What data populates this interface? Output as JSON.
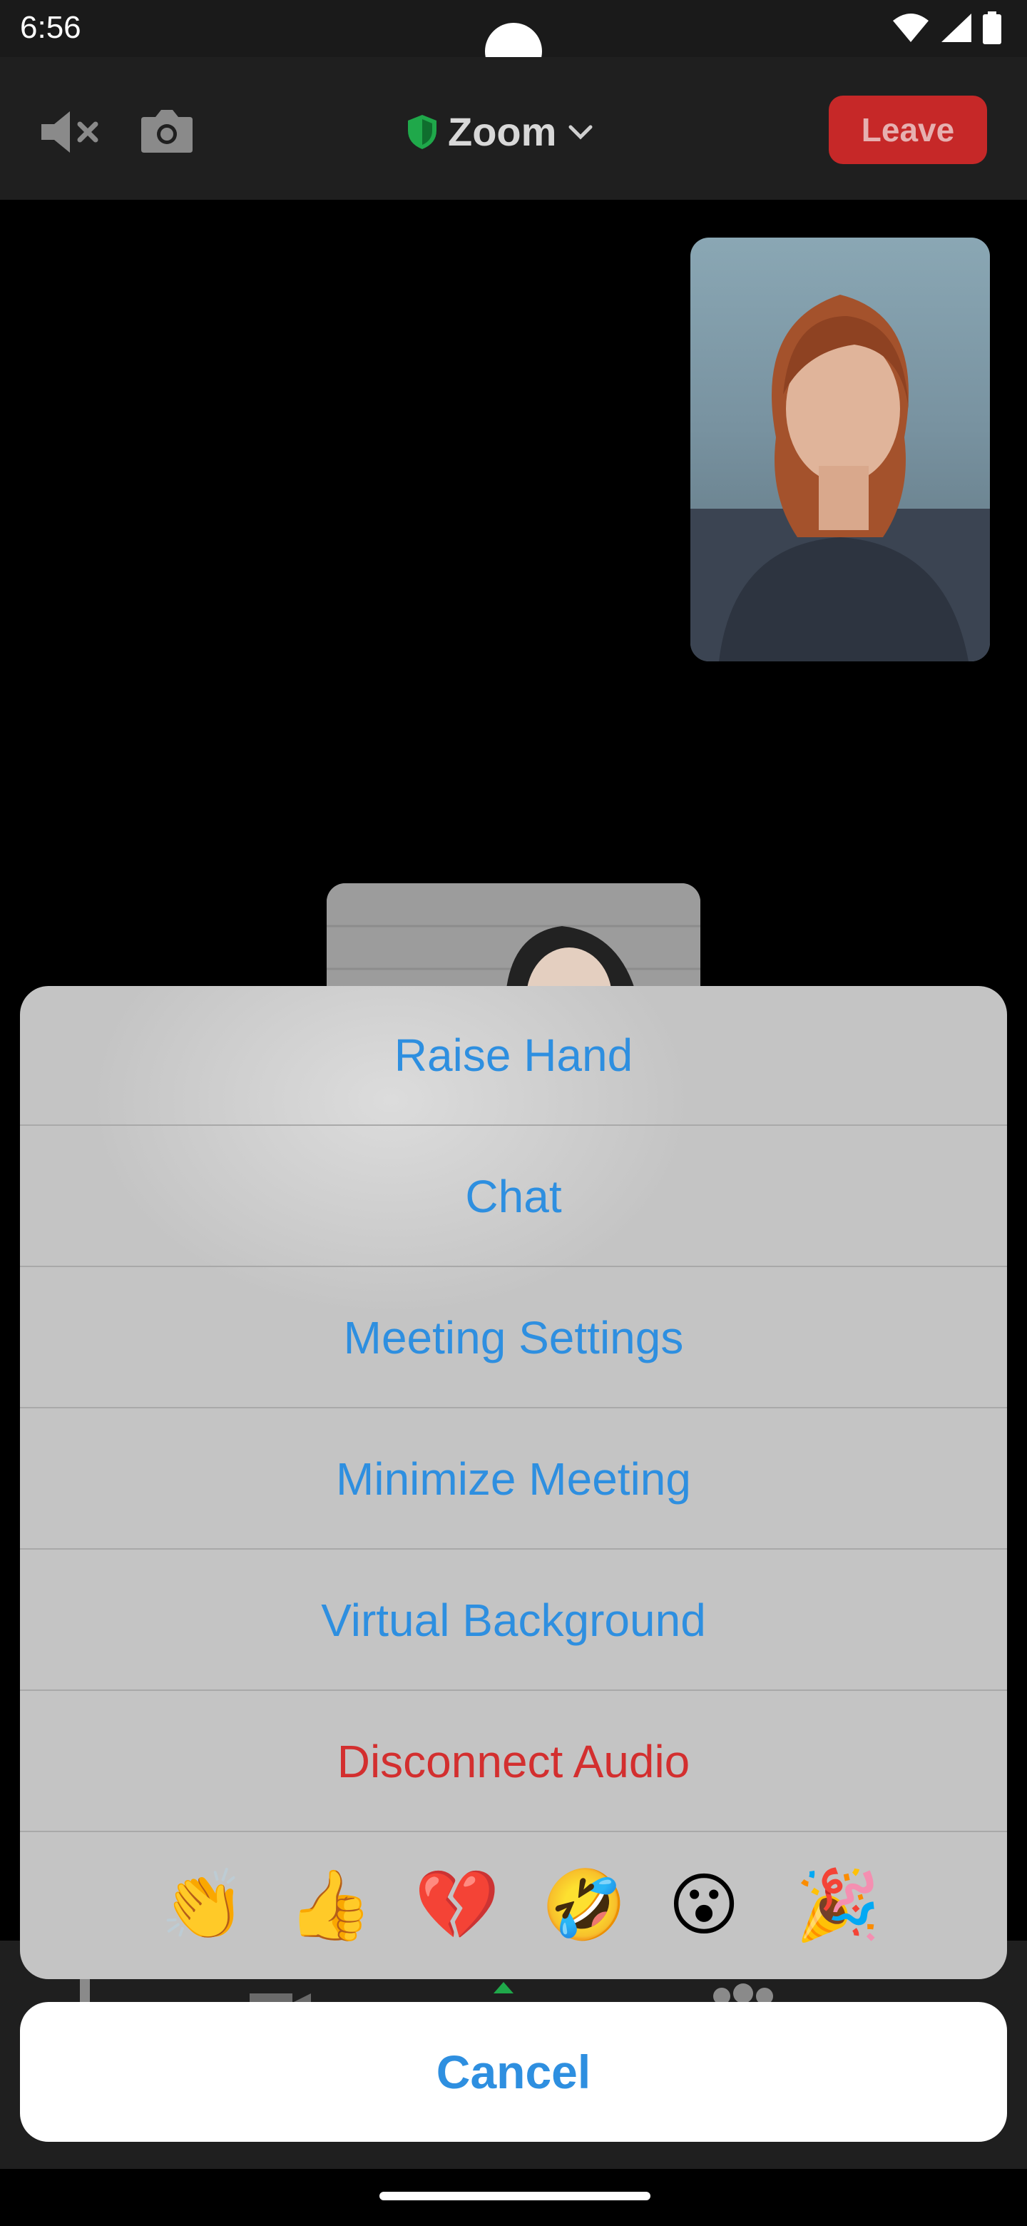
{
  "status_bar": {
    "time": "6:56"
  },
  "toolbar": {
    "title": "Zoom",
    "leave_label": "Leave",
    "icons": [
      "speaker-muted-icon",
      "switch-camera-icon",
      "shield-icon",
      "chevron-down-icon"
    ]
  },
  "action_sheet": {
    "items": [
      {
        "label": "Raise Hand"
      },
      {
        "label": "Chat"
      },
      {
        "label": "Meeting Settings"
      },
      {
        "label": "Minimize Meeting"
      },
      {
        "label": "Virtual Background"
      },
      {
        "label": "Disconnect Audio"
      }
    ],
    "reactions": [
      {
        "name": "clap",
        "glyph": "👏"
      },
      {
        "name": "thumbs-up",
        "glyph": "👍"
      },
      {
        "name": "broken-heart",
        "glyph": "💔"
      },
      {
        "name": "rolling-laughing",
        "glyph": "🤣"
      },
      {
        "name": "surprised",
        "glyph": "😮"
      },
      {
        "name": "party-popper",
        "glyph": "🎉"
      }
    ]
  },
  "cancel_label": "Cancel",
  "colors": {
    "accent": "#2e8fe0",
    "danger": "#d32f2f",
    "leave": "#c62828",
    "shield": "#1fa84a"
  }
}
